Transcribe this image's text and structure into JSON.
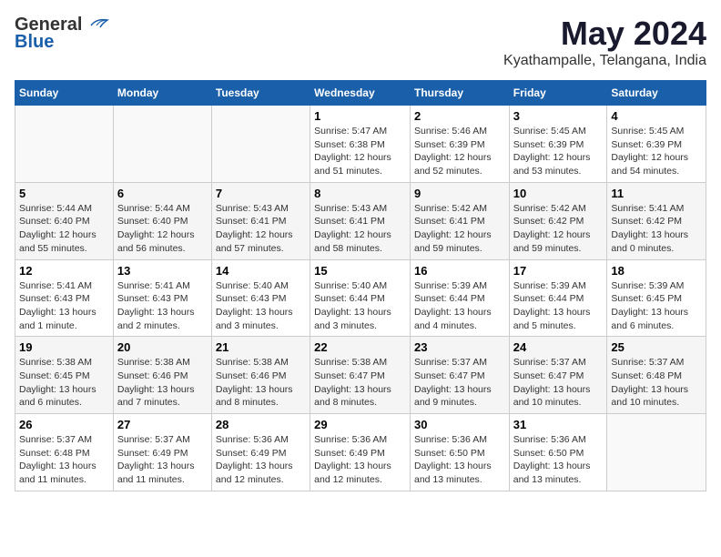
{
  "header": {
    "logo_general": "General",
    "logo_blue": "Blue",
    "month_year": "May 2024",
    "location": "Kyathampalle, Telangana, India"
  },
  "days_of_week": [
    "Sunday",
    "Monday",
    "Tuesday",
    "Wednesday",
    "Thursday",
    "Friday",
    "Saturday"
  ],
  "weeks": [
    [
      {
        "day": "",
        "info": ""
      },
      {
        "day": "",
        "info": ""
      },
      {
        "day": "",
        "info": ""
      },
      {
        "day": "1",
        "info": "Sunrise: 5:47 AM\nSunset: 6:38 PM\nDaylight: 12 hours\nand 51 minutes."
      },
      {
        "day": "2",
        "info": "Sunrise: 5:46 AM\nSunset: 6:39 PM\nDaylight: 12 hours\nand 52 minutes."
      },
      {
        "day": "3",
        "info": "Sunrise: 5:45 AM\nSunset: 6:39 PM\nDaylight: 12 hours\nand 53 minutes."
      },
      {
        "day": "4",
        "info": "Sunrise: 5:45 AM\nSunset: 6:39 PM\nDaylight: 12 hours\nand 54 minutes."
      }
    ],
    [
      {
        "day": "5",
        "info": "Sunrise: 5:44 AM\nSunset: 6:40 PM\nDaylight: 12 hours\nand 55 minutes."
      },
      {
        "day": "6",
        "info": "Sunrise: 5:44 AM\nSunset: 6:40 PM\nDaylight: 12 hours\nand 56 minutes."
      },
      {
        "day": "7",
        "info": "Sunrise: 5:43 AM\nSunset: 6:41 PM\nDaylight: 12 hours\nand 57 minutes."
      },
      {
        "day": "8",
        "info": "Sunrise: 5:43 AM\nSunset: 6:41 PM\nDaylight: 12 hours\nand 58 minutes."
      },
      {
        "day": "9",
        "info": "Sunrise: 5:42 AM\nSunset: 6:41 PM\nDaylight: 12 hours\nand 59 minutes."
      },
      {
        "day": "10",
        "info": "Sunrise: 5:42 AM\nSunset: 6:42 PM\nDaylight: 12 hours\nand 59 minutes."
      },
      {
        "day": "11",
        "info": "Sunrise: 5:41 AM\nSunset: 6:42 PM\nDaylight: 13 hours\nand 0 minutes."
      }
    ],
    [
      {
        "day": "12",
        "info": "Sunrise: 5:41 AM\nSunset: 6:43 PM\nDaylight: 13 hours\nand 1 minute."
      },
      {
        "day": "13",
        "info": "Sunrise: 5:41 AM\nSunset: 6:43 PM\nDaylight: 13 hours\nand 2 minutes."
      },
      {
        "day": "14",
        "info": "Sunrise: 5:40 AM\nSunset: 6:43 PM\nDaylight: 13 hours\nand 3 minutes."
      },
      {
        "day": "15",
        "info": "Sunrise: 5:40 AM\nSunset: 6:44 PM\nDaylight: 13 hours\nand 3 minutes."
      },
      {
        "day": "16",
        "info": "Sunrise: 5:39 AM\nSunset: 6:44 PM\nDaylight: 13 hours\nand 4 minutes."
      },
      {
        "day": "17",
        "info": "Sunrise: 5:39 AM\nSunset: 6:44 PM\nDaylight: 13 hours\nand 5 minutes."
      },
      {
        "day": "18",
        "info": "Sunrise: 5:39 AM\nSunset: 6:45 PM\nDaylight: 13 hours\nand 6 minutes."
      }
    ],
    [
      {
        "day": "19",
        "info": "Sunrise: 5:38 AM\nSunset: 6:45 PM\nDaylight: 13 hours\nand 6 minutes."
      },
      {
        "day": "20",
        "info": "Sunrise: 5:38 AM\nSunset: 6:46 PM\nDaylight: 13 hours\nand 7 minutes."
      },
      {
        "day": "21",
        "info": "Sunrise: 5:38 AM\nSunset: 6:46 PM\nDaylight: 13 hours\nand 8 minutes."
      },
      {
        "day": "22",
        "info": "Sunrise: 5:38 AM\nSunset: 6:47 PM\nDaylight: 13 hours\nand 8 minutes."
      },
      {
        "day": "23",
        "info": "Sunrise: 5:37 AM\nSunset: 6:47 PM\nDaylight: 13 hours\nand 9 minutes."
      },
      {
        "day": "24",
        "info": "Sunrise: 5:37 AM\nSunset: 6:47 PM\nDaylight: 13 hours\nand 10 minutes."
      },
      {
        "day": "25",
        "info": "Sunrise: 5:37 AM\nSunset: 6:48 PM\nDaylight: 13 hours\nand 10 minutes."
      }
    ],
    [
      {
        "day": "26",
        "info": "Sunrise: 5:37 AM\nSunset: 6:48 PM\nDaylight: 13 hours\nand 11 minutes."
      },
      {
        "day": "27",
        "info": "Sunrise: 5:37 AM\nSunset: 6:49 PM\nDaylight: 13 hours\nand 11 minutes."
      },
      {
        "day": "28",
        "info": "Sunrise: 5:36 AM\nSunset: 6:49 PM\nDaylight: 13 hours\nand 12 minutes."
      },
      {
        "day": "29",
        "info": "Sunrise: 5:36 AM\nSunset: 6:49 PM\nDaylight: 13 hours\nand 12 minutes."
      },
      {
        "day": "30",
        "info": "Sunrise: 5:36 AM\nSunset: 6:50 PM\nDaylight: 13 hours\nand 13 minutes."
      },
      {
        "day": "31",
        "info": "Sunrise: 5:36 AM\nSunset: 6:50 PM\nDaylight: 13 hours\nand 13 minutes."
      },
      {
        "day": "",
        "info": ""
      }
    ]
  ]
}
